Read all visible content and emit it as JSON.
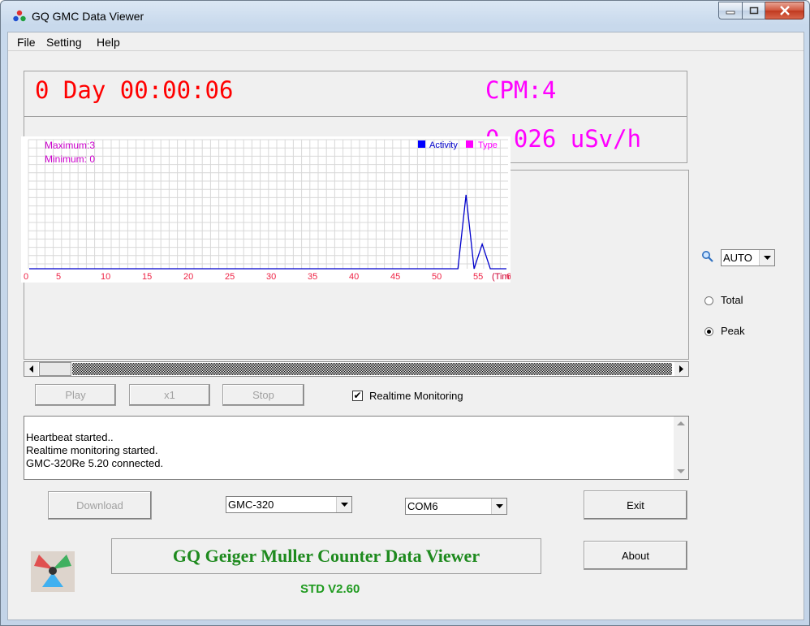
{
  "window": {
    "title": "GQ GMC Data Viewer"
  },
  "menu": [
    "File",
    "Setting",
    "Help"
  ],
  "display": {
    "timer": "0 Day 00:00:06",
    "cpm": "CPM:4",
    "dose": "0.026 uSv/h"
  },
  "chart_data": {
    "type": "line",
    "legend": [
      "Activity",
      "Type"
    ],
    "annotations": {
      "maximum": "Maximum:3",
      "minimum": "Minimum: 0"
    },
    "x_tick_labels": [
      "0",
      "5",
      "10",
      "15",
      "20",
      "25",
      "30",
      "35",
      "40",
      "45",
      "50",
      "55",
      "(Time)",
      "6"
    ],
    "x": [
      0,
      1,
      2,
      3,
      4,
      5,
      6,
      7,
      8,
      9,
      10,
      11,
      12,
      13,
      14,
      15,
      16,
      17,
      18,
      19,
      20,
      21,
      22,
      23,
      24,
      25,
      26,
      27,
      28,
      29,
      30,
      31,
      32,
      33,
      34,
      35,
      36,
      37,
      38,
      39,
      40,
      41,
      42,
      43,
      44,
      45,
      46,
      47,
      48,
      49,
      50,
      51,
      52,
      53,
      54,
      55,
      56,
      57,
      58,
      59
    ],
    "series": [
      {
        "name": "Activity",
        "color": "#0000cc",
        "values": [
          0,
          0,
          0,
          0,
          0,
          0,
          0,
          0,
          0,
          0,
          0,
          0,
          0,
          0,
          0,
          0,
          0,
          0,
          0,
          0,
          0,
          0,
          0,
          0,
          0,
          0,
          0,
          0,
          0,
          0,
          0,
          0,
          0,
          0,
          0,
          0,
          0,
          0,
          0,
          0,
          0,
          0,
          0,
          0,
          0,
          0,
          0,
          0,
          0,
          0,
          0,
          0,
          0,
          0,
          3,
          0,
          1,
          0,
          0,
          0
        ]
      }
    ],
    "ylim": [
      0,
      3
    ],
    "xlim": [
      0,
      59
    ],
    "grid": true,
    "legend_position": "top-right"
  },
  "controls": {
    "play": "Play",
    "speed": "x1",
    "stop": "Stop",
    "realtime": "Realtime Monitoring",
    "realtime_checked": "✔",
    "zoom_value": "AUTO",
    "radio_total": "Total",
    "radio_peak": "Peak",
    "selected_mode": "Peak"
  },
  "log": [
    "Heartbeat started..",
    "Realtime monitoring started.",
    "GMC-320Re 5.20 connected."
  ],
  "bottom": {
    "download": "Download",
    "model": "GMC-320",
    "port": "COM6",
    "exit": "Exit",
    "about": "About",
    "banner": "GQ Geiger Muller Counter Data Viewer",
    "version": "STD V2.60"
  },
  "colors": {
    "accent_red": "#ff0000",
    "accent_magenta": "#ff00ff",
    "activity_blue": "#0000cc",
    "banner_green": "#1e8a1e"
  }
}
